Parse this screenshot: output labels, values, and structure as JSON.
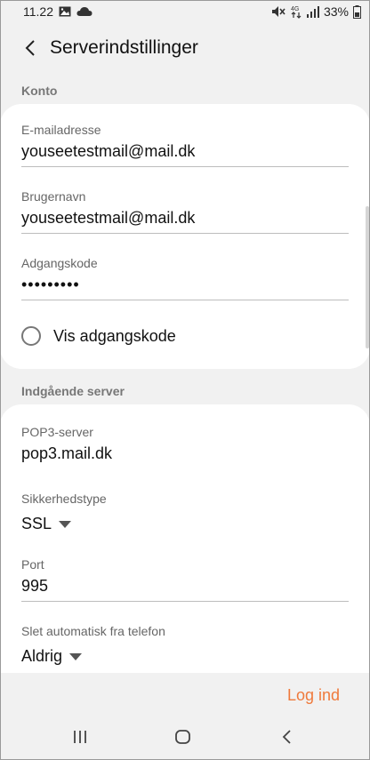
{
  "status": {
    "time": "11.22",
    "battery": "33%",
    "icons": [
      "image-icon",
      "cloud-icon",
      "mute-icon",
      "4g-icon",
      "signal-icon",
      "battery-icon"
    ]
  },
  "header": {
    "title": "Serverindstillinger",
    "back_icon": "back-arrow-icon"
  },
  "account": {
    "section_label": "Konto",
    "email": {
      "label": "E-mailadresse",
      "value": "youseetestmail@mail.dk"
    },
    "username": {
      "label": "Brugernavn",
      "value": "youseetestmail@mail.dk"
    },
    "password": {
      "label": "Adgangskode",
      "value": "•••••••••"
    },
    "show_password": {
      "label": "Vis adgangskode",
      "checked": false
    }
  },
  "incoming": {
    "section_label": "Indgående server",
    "server": {
      "label": "POP3-server",
      "value": "pop3.mail.dk"
    },
    "security": {
      "label": "Sikkerhedstype",
      "value": "SSL"
    },
    "port": {
      "label": "Port",
      "value": "995"
    },
    "auto_delete": {
      "label": "Slet automatisk fra telefon",
      "value": "Aldrig"
    }
  },
  "actions": {
    "login_label": "Log ind",
    "accent_color": "#ef7a3c"
  },
  "navbar": {
    "icons": [
      "recent-apps-icon",
      "home-icon",
      "back-icon"
    ]
  }
}
